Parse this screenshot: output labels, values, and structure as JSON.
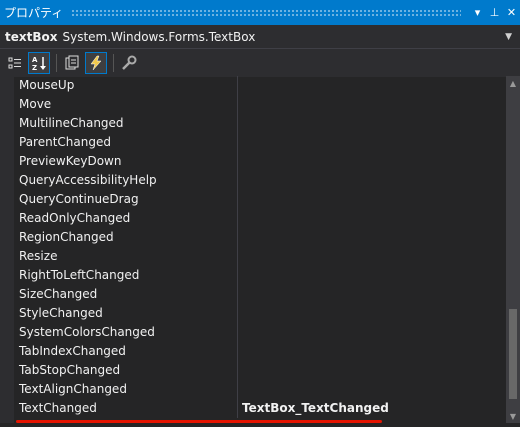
{
  "window": {
    "title": "プロパティ"
  },
  "titlebar_buttons": {
    "dropdown": "▾",
    "pin": "⊥",
    "close": "✕"
  },
  "selector": {
    "name": "textBox",
    "type": "System.Windows.Forms.TextBox",
    "arrow": "▼"
  },
  "toolbar": {
    "buttons": [
      {
        "name": "categorized-icon",
        "active": false
      },
      {
        "name": "alphabetical-icon",
        "active": true
      },
      {
        "name": "properties-icon",
        "active": false
      },
      {
        "name": "events-icon",
        "active": true
      },
      {
        "name": "property-pages-icon",
        "active": false
      }
    ]
  },
  "events": [
    {
      "name": "MouseUp",
      "value": ""
    },
    {
      "name": "Move",
      "value": ""
    },
    {
      "name": "MultilineChanged",
      "value": ""
    },
    {
      "name": "ParentChanged",
      "value": ""
    },
    {
      "name": "PreviewKeyDown",
      "value": ""
    },
    {
      "name": "QueryAccessibilityHelp",
      "value": ""
    },
    {
      "name": "QueryContinueDrag",
      "value": ""
    },
    {
      "name": "ReadOnlyChanged",
      "value": ""
    },
    {
      "name": "RegionChanged",
      "value": ""
    },
    {
      "name": "Resize",
      "value": ""
    },
    {
      "name": "RightToLeftChanged",
      "value": ""
    },
    {
      "name": "SizeChanged",
      "value": ""
    },
    {
      "name": "StyleChanged",
      "value": ""
    },
    {
      "name": "SystemColorsChanged",
      "value": ""
    },
    {
      "name": "TabIndexChanged",
      "value": ""
    },
    {
      "name": "TabStopChanged",
      "value": ""
    },
    {
      "name": "TextAlignChanged",
      "value": ""
    },
    {
      "name": "TextChanged",
      "value": "TextBox_TextChanged"
    }
  ],
  "scrollbar": {
    "up": "▲",
    "down": "▼"
  },
  "colors": {
    "accent": "#007acc",
    "highlight_underline": "#e51400"
  }
}
